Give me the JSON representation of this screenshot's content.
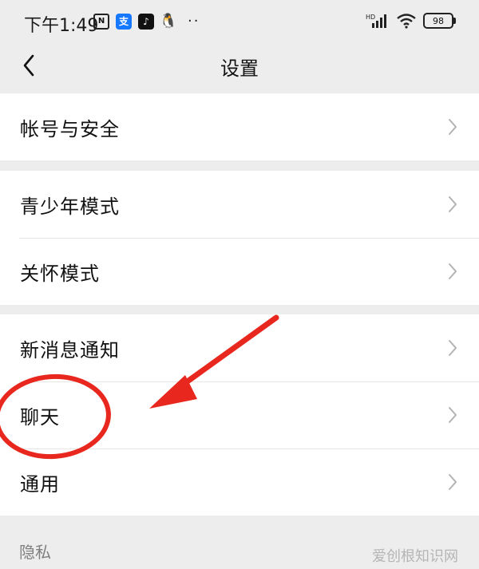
{
  "status_bar": {
    "time": "下午1:49",
    "battery": "98",
    "network": "HD"
  },
  "nav": {
    "title": "设置"
  },
  "groups": [
    {
      "items": [
        {
          "label": "帐号与安全"
        }
      ]
    },
    {
      "items": [
        {
          "label": "青少年模式"
        },
        {
          "label": "关怀模式"
        }
      ]
    },
    {
      "items": [
        {
          "label": "新消息通知"
        },
        {
          "label": "聊天"
        },
        {
          "label": "通用"
        }
      ]
    }
  ],
  "section": {
    "privacy_label": "隐私"
  },
  "watermark": "爱创根知识网",
  "colors": {
    "background": "#ededed",
    "card": "#ffffff",
    "annotation": "#e8281e"
  }
}
